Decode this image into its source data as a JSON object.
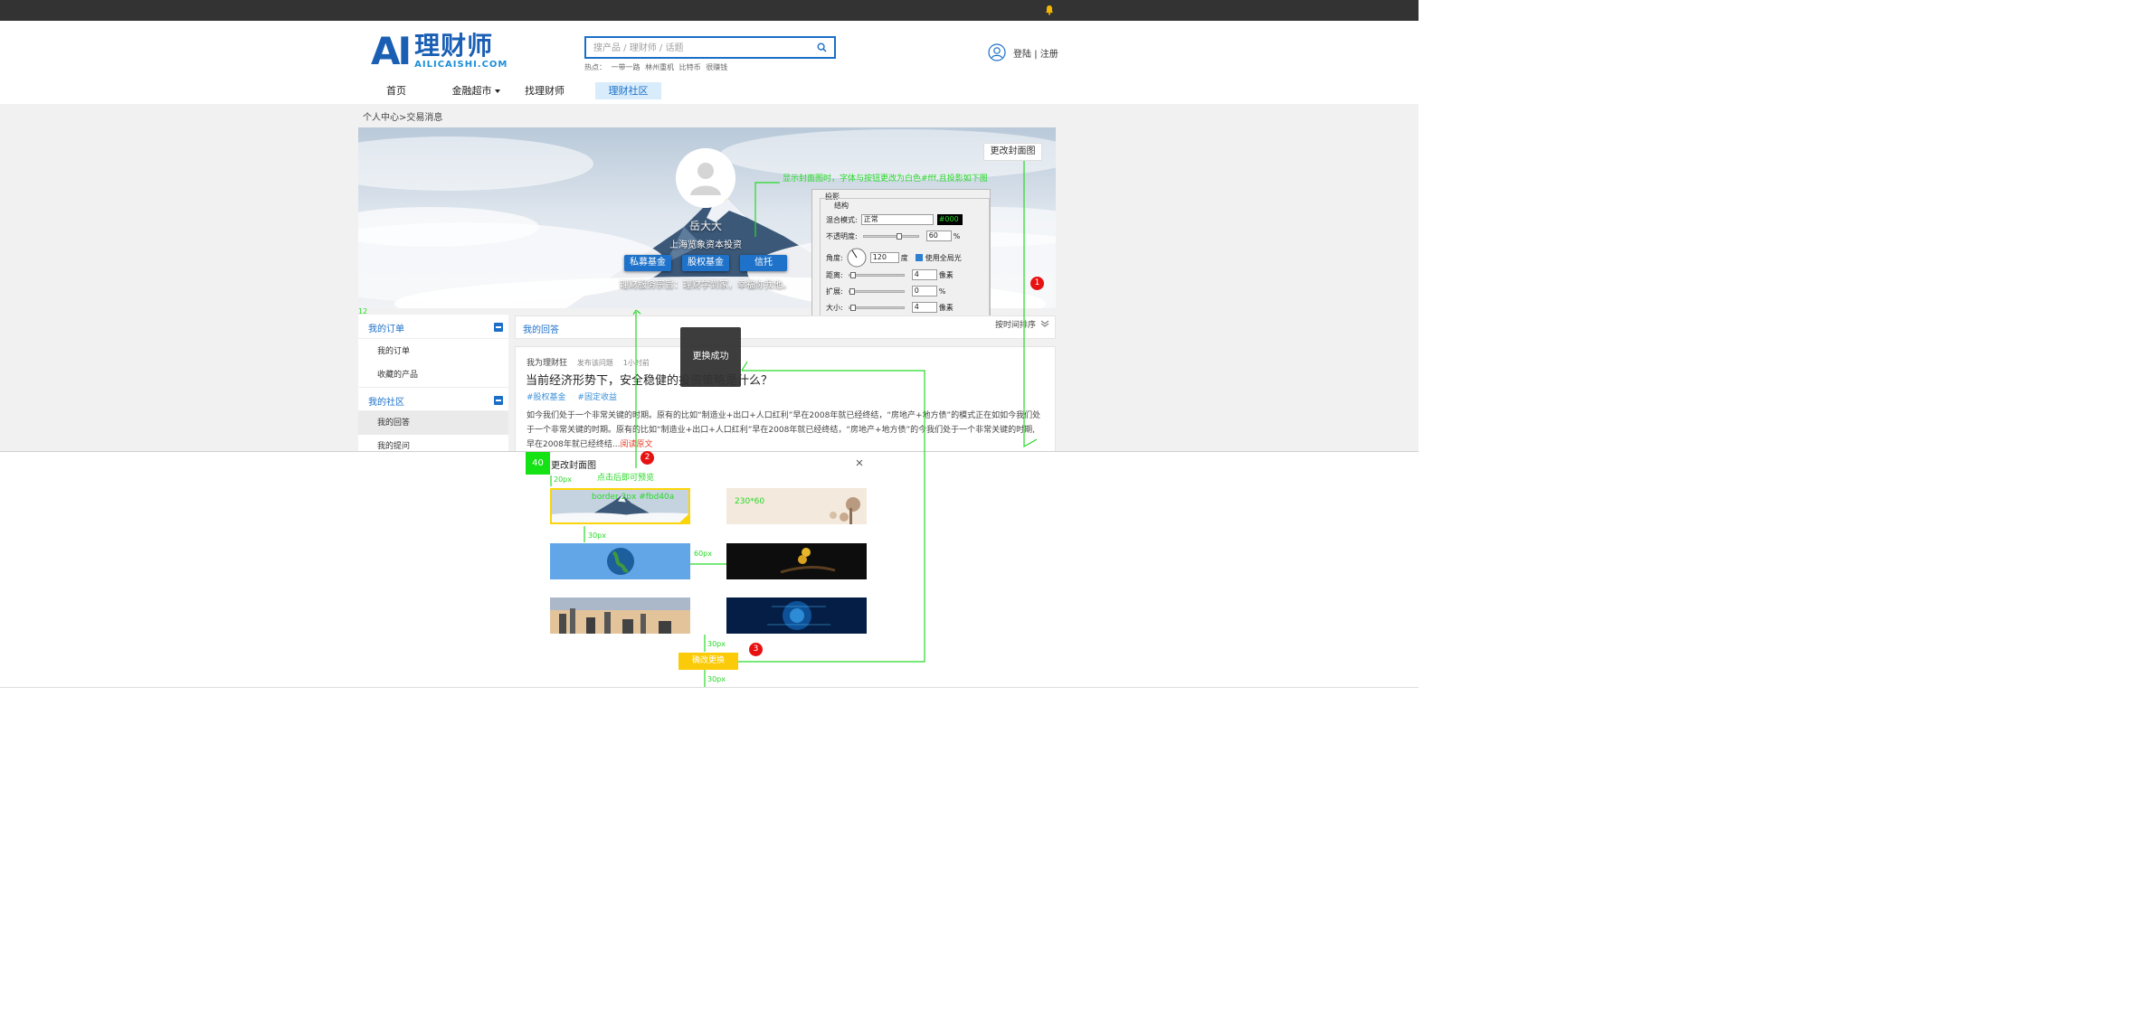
{
  "header": {
    "logo_mark": "AI",
    "logo_cn": "理财师",
    "logo_en": "AILICAISHI.COM",
    "search_placeholder": "搜产品 / 理财师 / 话题",
    "hot_label": "热点：",
    "hot_items": [
      "一带一路",
      "林州重机",
      "比特币",
      "很赚钱"
    ],
    "login": "登陆",
    "sep": "|",
    "register": "注册"
  },
  "nav": [
    {
      "label": "首页"
    },
    {
      "label": "金融超市"
    },
    {
      "label": "找理财师"
    },
    {
      "label": "理财社区"
    }
  ],
  "breadcrumb": "个人中心>交易消息",
  "profile": {
    "change_cover": "更改封面图",
    "name": "岳大大",
    "company": "上海览象资本投资",
    "tags": [
      "私募基金",
      "股权基金",
      "信托"
    ],
    "motto": "理财服务宗旨：理财学到家，幸福你我他。"
  },
  "ps_panel": {
    "title": "投影",
    "group": "结构",
    "blend_label": "混合模式:",
    "blend_value": "正常",
    "color_value": "#000",
    "opacity_label": "不透明度:",
    "opacity_value": "60",
    "angle_label": "角度:",
    "angle_value": "120",
    "angle_unit": "度",
    "global_light": "使用全局光",
    "distance_label": "距离:",
    "distance_value": "4",
    "spread_label": "扩展:",
    "spread_value": "0",
    "size_label": "大小:",
    "size_value": "4",
    "unit_px": "像素",
    "unit_pct": "%"
  },
  "sidebar": {
    "group1": "我的订单",
    "group1_items": [
      "我的订单",
      "收藏的产品"
    ],
    "group2": "我的社区",
    "group2_items": [
      "我的回答",
      "我的提问"
    ]
  },
  "content": {
    "tab": "我的回答",
    "sort": "按时间排序",
    "author": "我为理财狂",
    "action": "发布该问题",
    "time": "1小时前",
    "title": "当前经济形势下，安全稳健的投资策略是什么？",
    "tags": [
      "#股权基金",
      "#固定收益"
    ],
    "body": "如今我们处于一个非常关键的时期。原有的比如“制造业+出口+人口红利”早在2008年就已经终结，“房地产+地方债”的模式正在如如今我们处于一个非常关键的时期。原有的比如“制造业+出口+人口红利”早在2008年就已经终结，“房地产+地方债”的今我们处于一个非常关键的时期,早在2008年就已经终结...",
    "read_more": "阅读原文"
  },
  "toast": "更换成功",
  "modal": {
    "title": "更改封面图",
    "confirm": "确改更换"
  },
  "annotations": {
    "note_white": "显示封面图时，字体与按钮更改为白色#fff,且投影如下图",
    "spacing_12": "12",
    "box_40": "40",
    "px20": "20px",
    "click_preview": "点击后即可预览",
    "border_note": "border 2px #fbd40a",
    "size_note": "230*60",
    "px30a": "30px",
    "px60": "60px",
    "px30b": "30px",
    "px30c": "30px",
    "badge1": "1",
    "badge2": "2",
    "badge3": "3"
  },
  "colors": {
    "brand": "#1b6fc8",
    "annotation": "#27d927",
    "selected_border": "#fbd40a",
    "confirm": "#fbcb0a",
    "topbar": "#333333"
  },
  "icons": [
    "bell-icon",
    "search-icon",
    "user-icon",
    "chevron-down-icon",
    "minus-icon",
    "close-icon",
    "check-icon"
  ]
}
